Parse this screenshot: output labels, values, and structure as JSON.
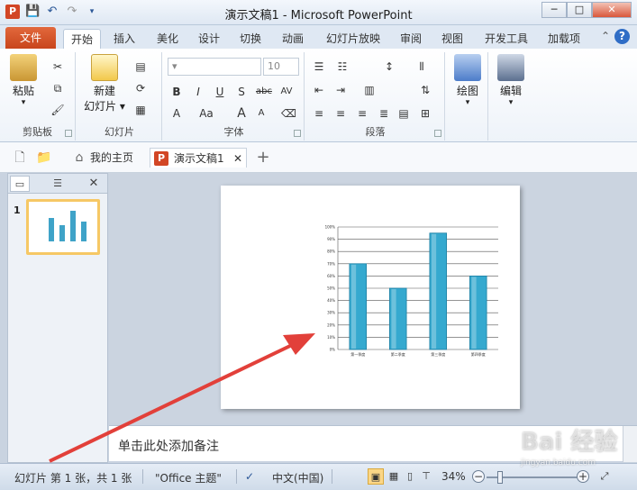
{
  "window": {
    "title": "演示文稿1 - Microsoft PowerPoint",
    "app_icon": "P",
    "controls": [
      "─",
      "□",
      "✕"
    ]
  },
  "qat": {
    "icons": [
      "save-icon",
      "undo-icon",
      "redo-icon",
      "customize-icon"
    ]
  },
  "ribbon_tabs": [
    "文件",
    "开始",
    "插入",
    "美化",
    "设计",
    "切换",
    "动画",
    "幻灯片放映",
    "审阅",
    "视图",
    "开发工具",
    "加载项"
  ],
  "active_tab": "开始",
  "ribbon": {
    "clipboard": {
      "paste": "粘贴",
      "label": "剪贴板"
    },
    "slides": {
      "new_slide": "新建\n幻灯片",
      "new_slide_line1": "新建",
      "new_slide_line2": "幻灯片 ▾",
      "label": "幻灯片"
    },
    "font": {
      "label": "字体",
      "size": "10",
      "buttons": [
        "B",
        "I",
        "U",
        "S",
        "abc",
        "AV",
        "A",
        "Aa",
        "A",
        "A"
      ]
    },
    "paragraph": {
      "label": "段落"
    },
    "drawing": {
      "label": "绘图"
    },
    "editing": {
      "label": "编辑"
    }
  },
  "doc_tabs": {
    "home": "我的主页",
    "document": "演示文稿1",
    "close": "✕",
    "add": "+"
  },
  "slide_panel": {
    "slide_number": "1",
    "close": "✕"
  },
  "chart_data": {
    "type": "bar",
    "categories": [
      "第一季度",
      "第二季度",
      "第三季度",
      "第四季度"
    ],
    "values": [
      70,
      50,
      95,
      60
    ],
    "ylim": [
      0,
      100
    ],
    "yticks": [
      "0%",
      "10%",
      "20%",
      "30%",
      "40%",
      "50%",
      "60%",
      "70%",
      "80%",
      "90%",
      "100%"
    ],
    "bar_color": "#35a9cf",
    "grid": true
  },
  "notes": {
    "placeholder": "单击此处添加备注"
  },
  "status": {
    "slide_info": "幻灯片 第 1 张，共 1 张",
    "theme": "\"Office 主题\"",
    "language": "中文(中国)",
    "zoom": "34%"
  },
  "watermark": {
    "text": "Bai 经验",
    "sub": "jingyan.baidu.com"
  },
  "colors": {
    "file_tab": "#d24625",
    "arrow": "#e2403a",
    "selection": "#f6c865"
  }
}
